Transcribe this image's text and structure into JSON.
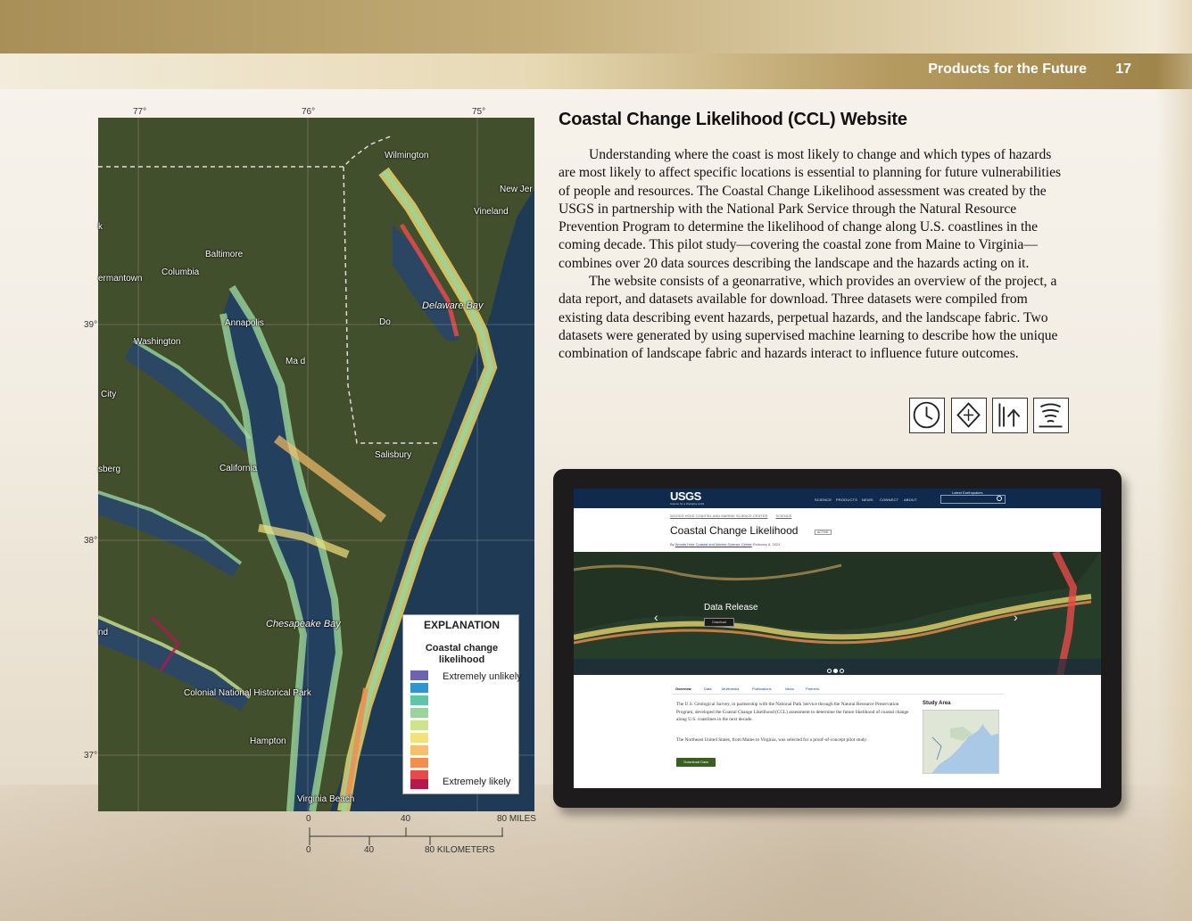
{
  "header": {
    "section_title": "Products for the Future",
    "page_number": "17"
  },
  "map": {
    "longitude_ticks": [
      "77°",
      "76°",
      "75°"
    ],
    "latitude_ticks": [
      "39°",
      "38°",
      "37°"
    ],
    "place_labels": {
      "wilmington": "Wilmington",
      "new_jersey": "New Jer",
      "vineland": "Vineland",
      "baltimore": "Baltimore",
      "columbia": "Columbia",
      "germantown": "ermantown",
      "delaware_bay": "Delaware Bay",
      "annapolis": "Annapolis",
      "dover": "Do",
      "washington": "Washington",
      "maryland": "Ma    d",
      "city": "City",
      "salisbury": "Salisbury",
      "fredericksburg": "sberg",
      "california": "California",
      "chesapeake_bay": "Chesapeake Bay",
      "richmond": "nd",
      "colonial": "Colonial National Historical Park",
      "hampton": "Hampton",
      "virginia_beach": "Virginia Beach",
      "k": "k"
    },
    "legend": {
      "title": "EXPLANATION",
      "subtitle": "Coastal change likelihood",
      "low_label": "Extremely unlikely",
      "high_label": "Extremely likely",
      "colors": [
        "#6b64b3",
        "#2d96d2",
        "#5cc6a8",
        "#9ad49a",
        "#cde38c",
        "#f3e27a",
        "#f7bf6a",
        "#f08d4f",
        "#e64b4a",
        "#b5174e"
      ]
    },
    "scale": {
      "miles": [
        "0",
        "40",
        "80 MILES"
      ],
      "kilometers": [
        "0",
        "40",
        "80 KILOMETERS"
      ]
    }
  },
  "article": {
    "title": "Coastal Change Likelihood (CCL) Website",
    "paragraphs": [
      "Understanding where the coast is most likely to change and which types of hazards are most likely to affect specific locations is essential to planning for future vulnerabilities of people and resources. The Coastal Change Likelihood assessment was created by the USGS in partnership with the National Park Service through the Natural Resource Prevention Program to determine the likelihood of change along U.S. coastlines in the coming decade. This pilot study—covering the coastal zone from Maine to Virginia—combines over 20 data sources describing the landscape and the hazards acting on it.",
      "The website consists of a geonarrative, which provides an overview of the project, a data report, and datasets available for download. Three datasets were compiled from existing data describing event hazards, perpetual hazards, and the landscape fabric. Two datasets were generated by using supervised machine learning to describe how the unique combination of landscape fabric and hazards interact to influence future outcomes."
    ],
    "icons": [
      "clock-icon",
      "ice-crystal-icon",
      "arrow-up-lines-icon",
      "storm-icon"
    ]
  },
  "website": {
    "logo": "USGS",
    "tagline": "science for a changing world",
    "nav": [
      "SCIENCE",
      "PRODUCTS",
      "NEWS",
      "CONNECT",
      "ABOUT"
    ],
    "top_link": "Latest Earthquakes",
    "breadcrumbs": [
      "WOODS HOLE COASTAL AND MARINE SCIENCE CENTER",
      "SCIENCE"
    ],
    "page_title": "Coastal Change Likelihood",
    "status": "ACTIVE",
    "byline_prefix": "By",
    "byline_org": "Woods Hole Coastal and Marine Science Center",
    "byline_date": "February 8, 2023",
    "hero_title": "Data Release",
    "hero_button": "Download",
    "tabs": [
      "Overview",
      "Data",
      "Multimedia",
      "Publications",
      "News",
      "Partners"
    ],
    "overview_paragraphs": [
      "The U.S. Geological Survey, in partnership with the National Park Service through the Natural Resource Preservation Program, developed the Coastal Change Likelihood (CCL) assessment to determine the future likelihood of coastal change along U.S. coastlines in the next decade.",
      "The Northeast United States, from Maine to Virginia, was selected for a proof-of-concept pilot study."
    ],
    "download_button": "Download Data",
    "study_area_title": "Study Area"
  }
}
